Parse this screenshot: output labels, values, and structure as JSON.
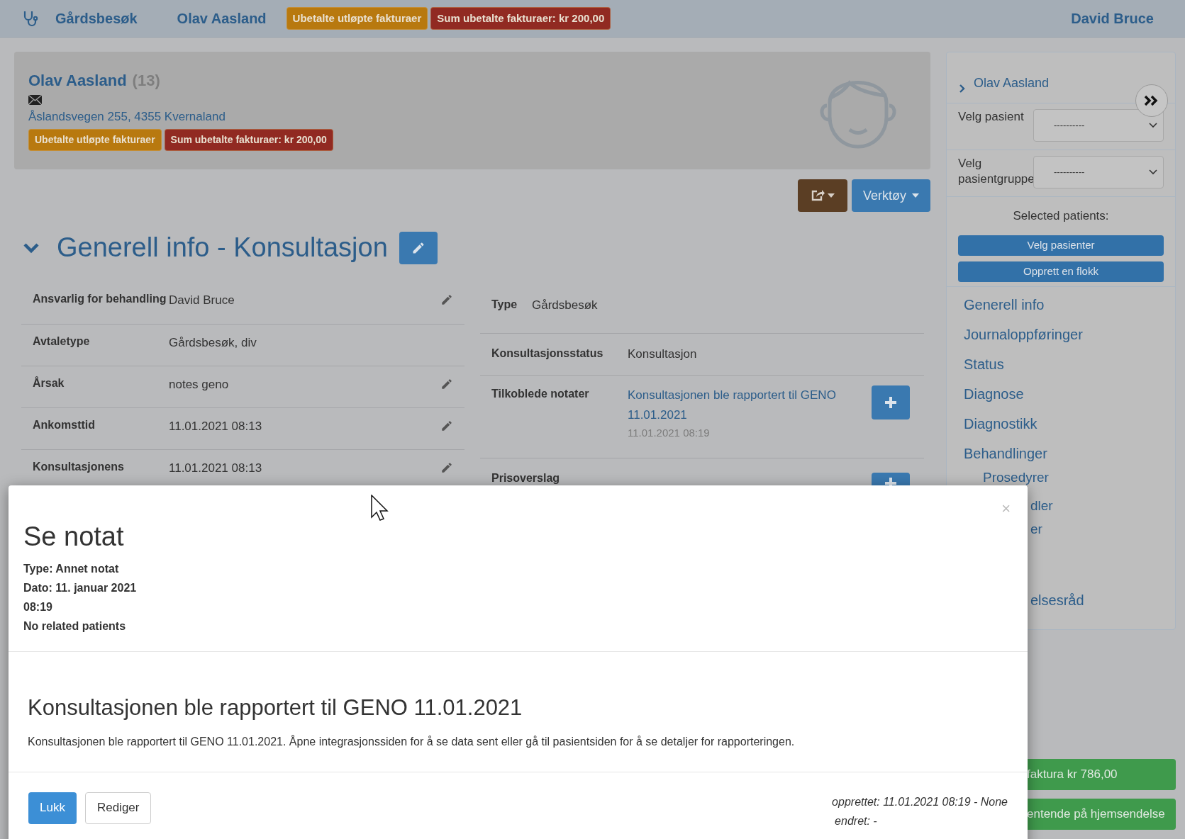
{
  "topbar": {
    "title": "Gårdsbesøk",
    "patient": "Olav Aasland",
    "user": "David Bruce",
    "badges": [
      {
        "text": "Ubetalte utløpte fakturaer",
        "color": "#b8790f"
      },
      {
        "text": "Sum ubetalte fakturaer: kr 200,00",
        "color": "#912a22"
      }
    ]
  },
  "patient_card": {
    "name": "Olav Aasland",
    "age": "(13)",
    "address": "Åslandsvegen 255, 4355 Kvernaland",
    "badges": [
      {
        "text": "Ubetalte utløpte fakturaer",
        "color": "#b8790f"
      },
      {
        "text": "Sum ubetalte fakturaer: kr 200,00",
        "color": "#912a22"
      }
    ]
  },
  "toolbar": [
    {
      "kind": "share"
    },
    {
      "kind": "menu",
      "label": "Verktøy"
    }
  ],
  "section": {
    "title": "Generell info - Konsultasjon",
    "expanded": true
  },
  "left_fields": [
    {
      "label": "Ansvarlig for behandling",
      "value": "David Bruce",
      "editable": true
    },
    {
      "label": "Avtaletype",
      "value": "Gårdsbesøk, div",
      "editable": false
    },
    {
      "label": "Årsak",
      "value": "notes geno",
      "editable": true
    },
    {
      "label": "Ankomsttid",
      "value": "11.01.2021 08:13",
      "editable": true
    },
    {
      "label": "Konsultasjonens",
      "value": "11.01.2021 08:13",
      "editable": true
    }
  ],
  "right_fields": [
    {
      "label": "Type",
      "value": "Gårdsbesøk"
    },
    {
      "label": "Konsultasjonsstatus",
      "value": "Konsultasjon"
    },
    {
      "label": "Tilkoblede notater",
      "link": "Konsultasjonen ble rapportert til GENO 11.01.2021",
      "time": "11.01.2021 08:19",
      "addable": true
    },
    {
      "label": "Prisoverslag",
      "addable": true
    }
  ],
  "sidebar": {
    "patient": "Olav Aasland",
    "selects": [
      {
        "label": "Velg pasient",
        "value": "----------"
      },
      {
        "label": "Velg pasientgruppe",
        "value": "----------"
      }
    ],
    "selected_label": "Selected patients:",
    "buttons": [
      "Velg pasienter",
      "Opprett en flokk"
    ],
    "nav": [
      {
        "label": "Generell info",
        "kind": "top"
      },
      {
        "label": "Journaloppføringer",
        "kind": "top"
      },
      {
        "label": "Status",
        "kind": "top"
      },
      {
        "label": "Diagnose",
        "kind": "top"
      },
      {
        "label": "Diagnostikk",
        "kind": "top"
      },
      {
        "label": "Behandlinger",
        "kind": "top"
      },
      {
        "label": "Prosedyrer",
        "kind": "sub"
      },
      {
        "label": "dler",
        "kind": "cut"
      },
      {
        "label": "er",
        "kind": "cut"
      },
      {
        "label": "elsesråd",
        "kind": "cut_low"
      }
    ]
  },
  "actions": [
    "faktura kr 786,00",
    "entende på hjemsendelse"
  ],
  "modal": {
    "close": "×",
    "title": "Se notat",
    "meta": [
      "Type: Annet notat",
      "Dato: 11. januar 2021",
      "08:19",
      "No related patients"
    ],
    "heading": "Konsultasjonen ble rapportert til GENO 11.01.2021",
    "body": "Konsultasjonen ble rapportert til GENO 11.01.2021. Åpne integrasjonssiden for å se data sent eller gå til pasientsiden for å se detaljer for rapporteringen.",
    "buttons": [
      {
        "label": "Lukk",
        "primary": true
      },
      {
        "label": "Rediger",
        "primary": false
      }
    ],
    "created": "opprettet: 11.01.2021 08:19 - None",
    "changed": "endret: -"
  }
}
